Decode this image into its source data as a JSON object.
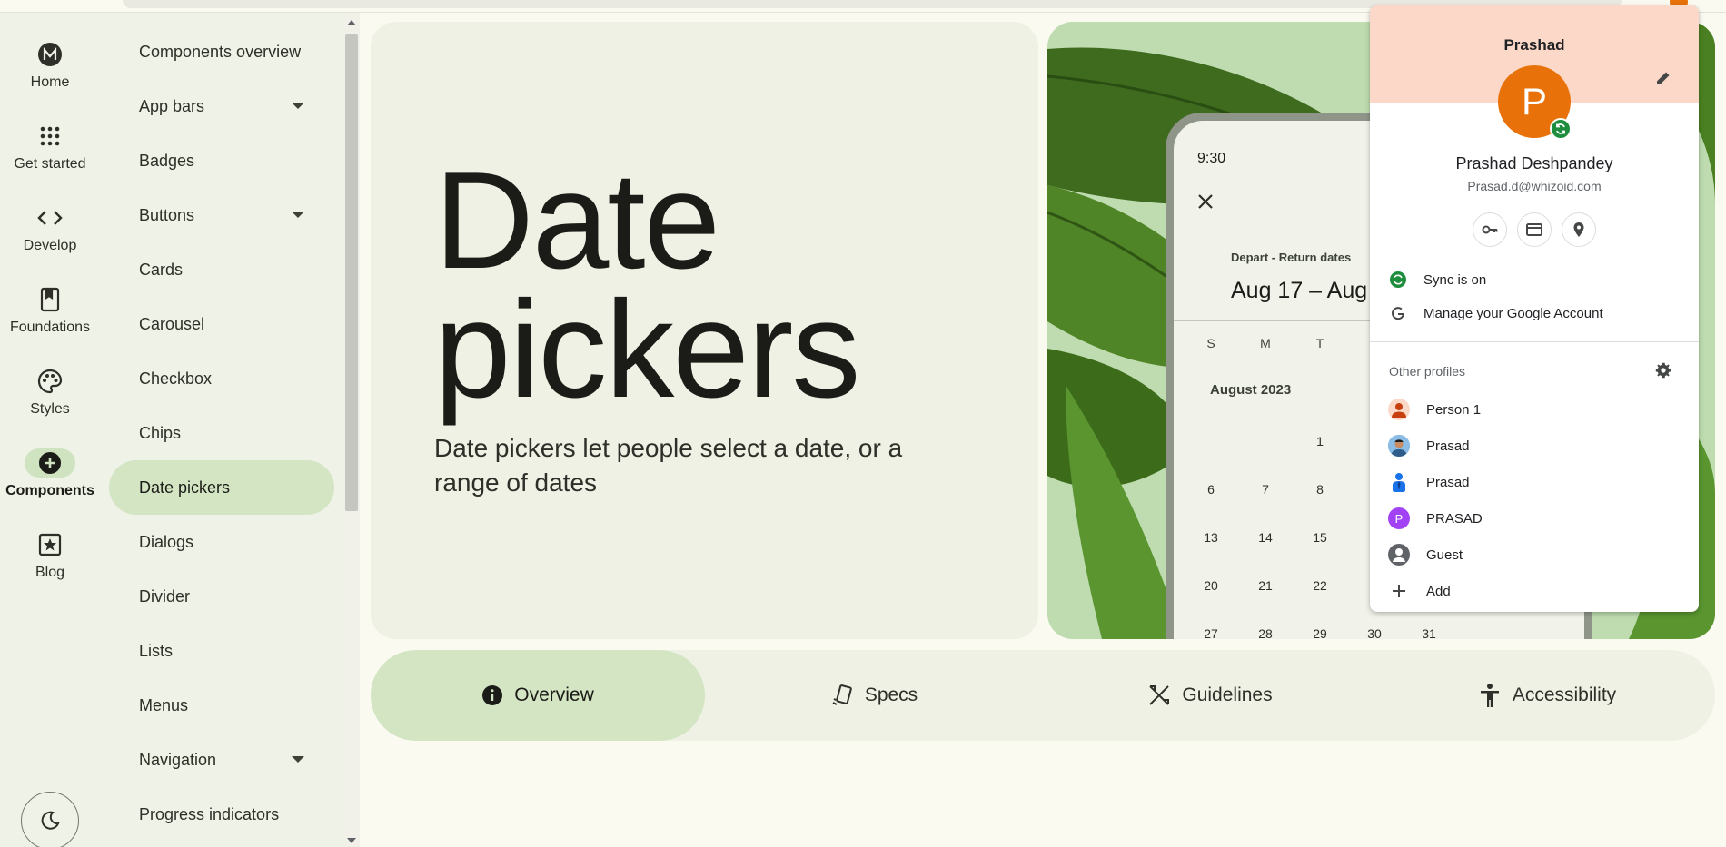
{
  "rail": {
    "items": [
      {
        "label": "Home",
        "icon": "material-logo-icon"
      },
      {
        "label": "Get started",
        "icon": "apps-grid-icon"
      },
      {
        "label": "Develop",
        "icon": "code-icon"
      },
      {
        "label": "Foundations",
        "icon": "book-icon"
      },
      {
        "label": "Styles",
        "icon": "palette-icon"
      },
      {
        "label": "Components",
        "icon": "add-circle-icon"
      },
      {
        "label": "Blog",
        "icon": "star-bookmark-icon"
      }
    ],
    "active_index": 5,
    "theme_toggle_icon": "moon-icon"
  },
  "components_list": {
    "items": [
      {
        "label": "Components overview",
        "expandable": false
      },
      {
        "label": "App bars",
        "expandable": true
      },
      {
        "label": "Badges",
        "expandable": false
      },
      {
        "label": "Buttons",
        "expandable": true
      },
      {
        "label": "Cards",
        "expandable": false
      },
      {
        "label": "Carousel",
        "expandable": false
      },
      {
        "label": "Checkbox",
        "expandable": false
      },
      {
        "label": "Chips",
        "expandable": false
      },
      {
        "label": "Date pickers",
        "expandable": false
      },
      {
        "label": "Dialogs",
        "expandable": false
      },
      {
        "label": "Divider",
        "expandable": false
      },
      {
        "label": "Lists",
        "expandable": false
      },
      {
        "label": "Menus",
        "expandable": false
      },
      {
        "label": "Navigation",
        "expandable": true
      },
      {
        "label": "Progress indicators",
        "expandable": false
      }
    ],
    "active_index": 8
  },
  "hero": {
    "title_line1": "Date",
    "title_line2": "pickers",
    "subtitle": "Date pickers let people select a date, or a range of dates"
  },
  "phone": {
    "time": "9:30",
    "label": "Depart - Return dates",
    "range": "Aug 17 – Aug",
    "weekdays": [
      "S",
      "M",
      "T"
    ],
    "month": "August 2023",
    "days": [
      {
        "d": "1",
        "col": 2,
        "row": 0
      },
      {
        "d": "6",
        "col": 0,
        "row": 1
      },
      {
        "d": "7",
        "col": 1,
        "row": 1
      },
      {
        "d": "8",
        "col": 2,
        "row": 1
      },
      {
        "d": "13",
        "col": 0,
        "row": 2
      },
      {
        "d": "14",
        "col": 1,
        "row": 2
      },
      {
        "d": "15",
        "col": 2,
        "row": 2
      },
      {
        "d": "20",
        "col": 0,
        "row": 3
      },
      {
        "d": "21",
        "col": 1,
        "row": 3
      },
      {
        "d": "22",
        "col": 2,
        "row": 3
      },
      {
        "d": "27",
        "col": 0,
        "row": 4
      },
      {
        "d": "28",
        "col": 1,
        "row": 4
      },
      {
        "d": "29",
        "col": 2,
        "row": 4
      },
      {
        "d": "30",
        "col": 3,
        "row": 4
      },
      {
        "d": "31",
        "col": 4,
        "row": 4
      }
    ]
  },
  "tabs": [
    {
      "label": "Overview",
      "icon": "info-icon"
    },
    {
      "label": "Specs",
      "icon": "specs-icon"
    },
    {
      "label": "Guidelines",
      "icon": "guidelines-icon"
    },
    {
      "label": "Accessibility",
      "icon": "accessibility-icon"
    }
  ],
  "active_tab": 0,
  "profile_popup": {
    "header_name": "Prashad",
    "avatar_letter": "P",
    "full_name": "Prashad Deshpandey",
    "email": "Prasad.d@whizoid.com",
    "quick_actions": [
      "key-icon",
      "card-icon",
      "location-pin-icon"
    ],
    "sync_label": "Sync is on",
    "manage_label": "Manage your Google Account",
    "other_profiles_label": "Other profiles",
    "profiles": [
      {
        "name": "Person 1",
        "avatar": "person-orange"
      },
      {
        "name": "Prasad",
        "avatar": "photo"
      },
      {
        "name": "Prasad",
        "avatar": "person-blue"
      },
      {
        "name": "PRASAD",
        "avatar": "letter-purple",
        "letter": "P"
      },
      {
        "name": "Guest",
        "avatar": "guest-gray"
      },
      {
        "name": "Add",
        "avatar": "plus"
      }
    ],
    "colors": {
      "header_bg": "#fbd8c7",
      "avatar_bg": "#e8710a",
      "sync_green": "#1e8e3e"
    }
  }
}
